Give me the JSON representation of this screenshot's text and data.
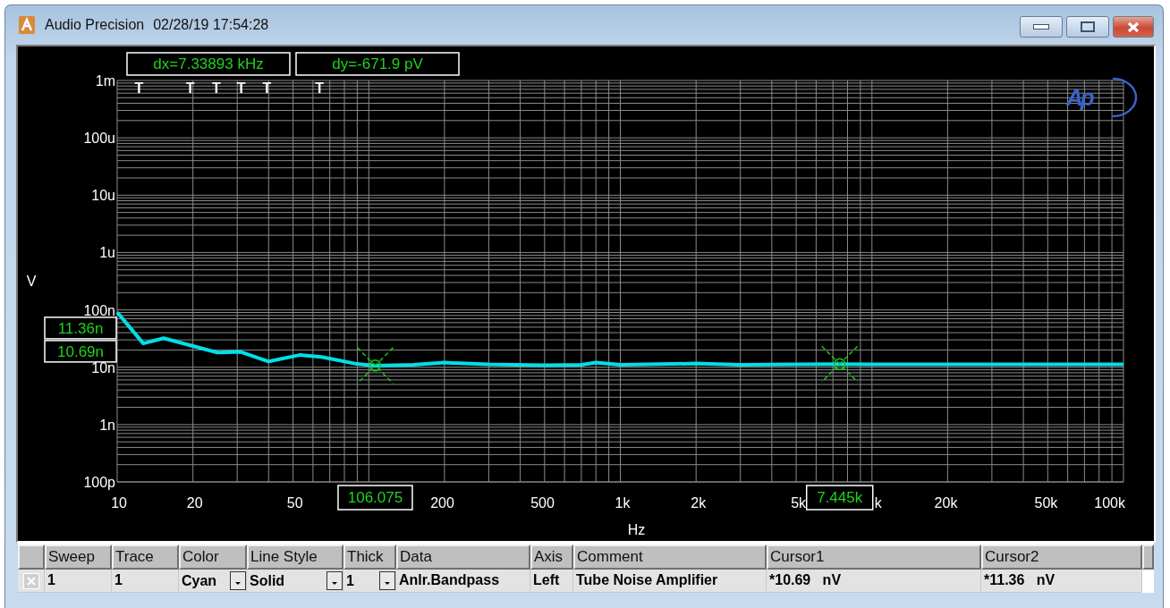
{
  "window": {
    "title": "Audio Precision",
    "timestamp": "02/28/19 17:54:28"
  },
  "graph": {
    "logo": "Ap",
    "readouts": [
      "dx=7.33893 kHz",
      "dy=-671.9  pV"
    ],
    "y_axis_title": "V",
    "x_axis_title": "Hz",
    "y_axis_labels": [
      "1m",
      "100u",
      "10u",
      "1u",
      "100n",
      "10n",
      "1n",
      "100p"
    ],
    "x_axis_labels": [
      "10",
      "20",
      "50",
      "200",
      "500",
      "1k",
      "2k",
      "5k",
      "k",
      "20k",
      "50k",
      "100k"
    ],
    "markers": [
      "T",
      "T",
      "T",
      "T",
      "T",
      "T"
    ],
    "cursor_y_readouts": [
      "11.36n",
      "10.69n"
    ],
    "cursor_x_readouts": [
      "106.075",
      "7.445k"
    ]
  },
  "trace_table": {
    "columns": [
      "Sweep",
      "Trace",
      "Color",
      "Line Style",
      "Thick",
      "Data",
      "Axis",
      "Comment",
      "Cursor1",
      "Cursor2"
    ],
    "rows": [
      {
        "checked": true,
        "cells": [
          {
            "text": "1",
            "kind": "text"
          },
          {
            "text": "1",
            "kind": "text"
          },
          {
            "text": "Cyan",
            "kind": "dropdown"
          },
          {
            "text": "Solid",
            "kind": "dropdown"
          },
          {
            "text": "1",
            "kind": "dropdown"
          },
          {
            "text": "Anlr.Bandpass",
            "kind": "text"
          },
          {
            "text": "Left",
            "kind": "text"
          },
          {
            "text": "Tube Noise Amplifier",
            "kind": "text"
          },
          {
            "text": "*10.69   nV",
            "kind": "text"
          },
          {
            "text": "*11.36   nV",
            "kind": "text"
          }
        ]
      }
    ]
  }
}
